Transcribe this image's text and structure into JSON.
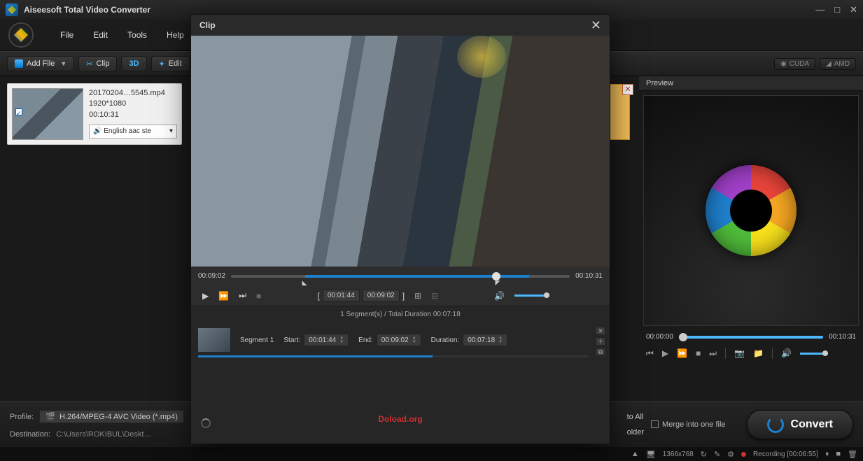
{
  "app": {
    "title": "Aiseesoft Total Video Converter"
  },
  "menu": {
    "file": "File",
    "edit": "Edit",
    "tools": "Tools",
    "help": "Help"
  },
  "toolbar": {
    "add_file": "Add File",
    "clip": "Clip",
    "threed": "3D",
    "edit": "Edit",
    "cuda": "CUDA",
    "amd": "AMD"
  },
  "file_item": {
    "filename": "20170204…5545.mp4",
    "resolution": "1920*1080",
    "duration": "00:10:31",
    "audio_track": "English aac ste"
  },
  "preview": {
    "header": "Preview",
    "start": "00:00:00",
    "end": "00:10:31"
  },
  "bottom": {
    "profile_label": "Profile:",
    "profile_value": "H.264/MPEG-4 AVC Video (*.mp4)",
    "destination_label": "Destination:",
    "destination_value": "C:\\Users\\ROKIBUL\\Deskt…",
    "apply_to_all": "to All",
    "open_folder": "older",
    "merge": "Merge into one file",
    "convert": "Convert"
  },
  "clip_modal": {
    "title": "Clip",
    "time_current": "00:09:02",
    "time_total": "00:10:31",
    "bracket_start": "00:01:44",
    "bracket_end": "00:09:02",
    "segments_line": "1 Segment(s) / Total Duration 00:07:18",
    "segment_name": "Segment 1",
    "start_label": "Start:",
    "start_value": "00:01:44",
    "end_label": "End:",
    "end_value": "00:09:02",
    "duration_label": "Duration:",
    "duration_value": "00:07:18",
    "watermark": "Doload.org"
  },
  "tray": {
    "resolution": "1366x768",
    "recording": "Recording [00:06:55]"
  }
}
